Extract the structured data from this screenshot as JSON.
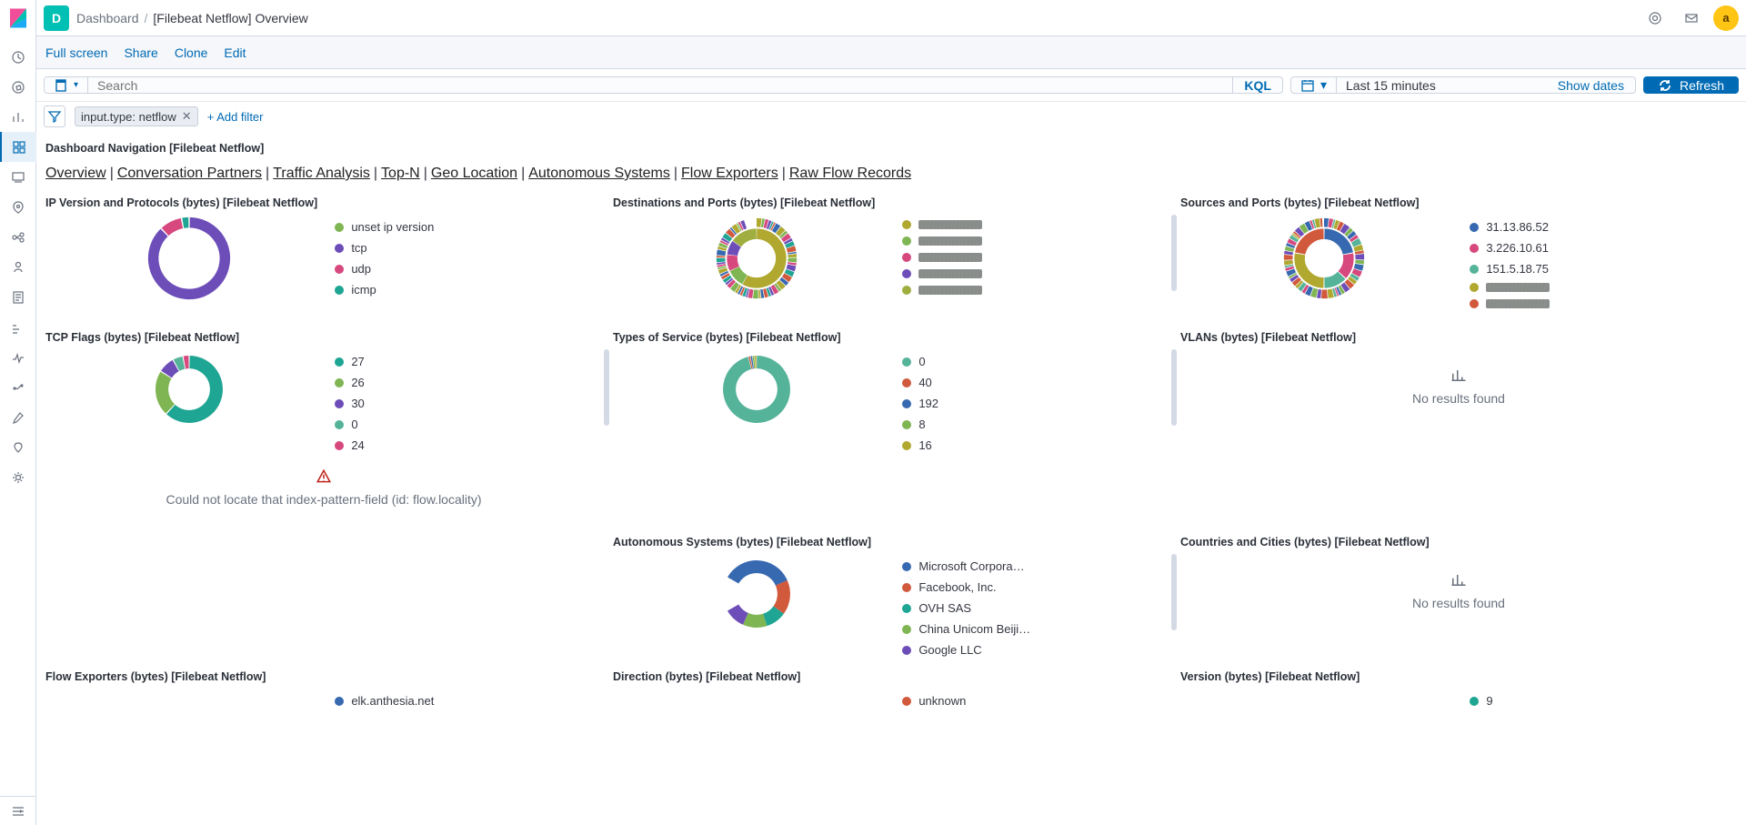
{
  "app": {
    "space_initial": "D",
    "breadcrumb_root": "Dashboard",
    "breadcrumb_current": "[Filebeat Netflow] Overview",
    "avatar_initial": "a"
  },
  "toolbar": {
    "fullscreen": "Full screen",
    "share": "Share",
    "clone": "Clone",
    "edit": "Edit"
  },
  "search": {
    "placeholder": "Search",
    "lang": "KQL"
  },
  "time": {
    "range": "Last 15 minutes",
    "show_dates": "Show dates",
    "refresh": "Refresh"
  },
  "filters": {
    "pill": "input.type: netflow",
    "add": "+ Add filter"
  },
  "nav_panel_title": "Dashboard Navigation [Filebeat Netflow]",
  "nav_links": [
    "Overview",
    "Conversation Partners",
    "Traffic Analysis",
    "Top-N",
    "Geo Location",
    "Autonomous Systems",
    "Flow Exporters",
    "Raw Flow Records"
  ],
  "panels": {
    "ipver": "IP Version and Protocols (bytes) [Filebeat Netflow]",
    "dest": "Destinations and Ports (bytes) [Filebeat Netflow]",
    "src": "Sources and Ports (bytes) [Filebeat Netflow]",
    "tcp": "TCP Flags (bytes) [Filebeat Netflow]",
    "tos": "Types of Service (bytes) [Filebeat Netflow]",
    "vlan": "VLANs (bytes) [Filebeat Netflow]",
    "as": "Autonomous Systems (bytes) [Filebeat Netflow]",
    "cc": "Countries and Cities (bytes) [Filebeat Netflow]",
    "fe": "Flow Exporters (bytes) [Filebeat Netflow]",
    "dir": "Direction (bytes) [Filebeat Netflow]",
    "ver": "Version (bytes) [Filebeat Netflow]"
  },
  "no_results": "No results found",
  "error_locality": "Could not locate that index-pattern-field (id: flow.locality)",
  "chart_data": [
    {
      "id": "ipver",
      "type": "pie",
      "title": "IP Version and Protocols (bytes)",
      "ring": 0,
      "series": [
        {
          "name": "unset ip version",
          "value": 100,
          "color": "#54b399"
        }
      ]
    },
    {
      "id": "ipver",
      "type": "pie",
      "title": "IP Version and Protocols – protocol",
      "ring": 1,
      "series": [
        {
          "name": "tcp",
          "value": 88,
          "color": "#6d4db8"
        },
        {
          "name": "udp",
          "value": 9,
          "color": "#d6487e"
        },
        {
          "name": "icmp",
          "value": 3,
          "color": "#1ea593"
        }
      ]
    },
    {
      "id": "dest",
      "type": "pie",
      "title": "Destinations and Ports (bytes)",
      "note": "legend labels unreadable",
      "series": [
        {
          "name": "dest-1",
          "value": 58,
          "color": "#b0a82f"
        },
        {
          "name": "dest-2",
          "value": 10,
          "color": "#7fb553"
        },
        {
          "name": "dest-3",
          "value": 9,
          "color": "#d6487e"
        },
        {
          "name": "dest-4",
          "value": 8,
          "color": "#6d4db8"
        },
        {
          "name": "dest-5",
          "value": 15,
          "color": "#9fae3f"
        }
      ]
    },
    {
      "id": "src",
      "type": "pie",
      "title": "Sources and Ports (bytes)",
      "series": [
        {
          "name": "31.13.86.52",
          "value": 22,
          "color": "#3769b1"
        },
        {
          "name": "3.226.10.61",
          "value": 15,
          "color": "#d6487e"
        },
        {
          "name": "151.5.18.75",
          "value": 13,
          "color": "#54b399"
        },
        {
          "name": "src-4",
          "value": 28,
          "color": "#b0a82f"
        },
        {
          "name": "src-5",
          "value": 22,
          "color": "#d1593c"
        }
      ]
    },
    {
      "id": "tcp",
      "type": "pie",
      "title": "TCP Flags (bytes)",
      "series": [
        {
          "name": "27",
          "value": 62,
          "color": "#1ea593"
        },
        {
          "name": "26",
          "value": 22,
          "color": "#7fb553"
        },
        {
          "name": "30",
          "value": 8,
          "color": "#6d4db8"
        },
        {
          "name": "0",
          "value": 5,
          "color": "#54b399"
        },
        {
          "name": "24",
          "value": 3,
          "color": "#d6487e"
        }
      ]
    },
    {
      "id": "tos",
      "type": "pie",
      "title": "Types of Service (bytes)",
      "series": [
        {
          "name": "0",
          "value": 96,
          "color": "#54b399"
        },
        {
          "name": "40",
          "value": 1,
          "color": "#d1593c"
        },
        {
          "name": "192",
          "value": 1,
          "color": "#3769b1"
        },
        {
          "name": "8",
          "value": 1,
          "color": "#7fb553"
        },
        {
          "name": "16",
          "value": 1,
          "color": "#b0a82f"
        }
      ]
    },
    {
      "id": "vlan",
      "type": "pie",
      "title": "VLANs (bytes)",
      "series": [],
      "empty": true
    },
    {
      "id": "as",
      "type": "pie",
      "title": "Autonomous Systems (bytes)",
      "series": [
        {
          "name": "Microsoft Corpora…",
          "value": 42,
          "color": "#3769b1"
        },
        {
          "name": "Facebook, Inc.",
          "value": 20,
          "color": "#d1593c"
        },
        {
          "name": "OVH SAS",
          "value": 12,
          "color": "#1ea593"
        },
        {
          "name": "China Unicom Beiji…",
          "value": 14,
          "color": "#7fb553"
        },
        {
          "name": "Google LLC",
          "value": 12,
          "color": "#6d4db8"
        }
      ]
    },
    {
      "id": "cc",
      "type": "pie",
      "title": "Countries and Cities (bytes)",
      "series": [],
      "empty": true
    },
    {
      "id": "fe",
      "type": "pie",
      "title": "Flow Exporters (bytes)",
      "series": [
        {
          "name": "elk.anthesia.net",
          "value": 100,
          "color": "#3769b1"
        }
      ]
    },
    {
      "id": "dir",
      "type": "pie",
      "title": "Direction (bytes)",
      "series": [
        {
          "name": "unknown",
          "value": 100,
          "color": "#d1593c"
        }
      ]
    },
    {
      "id": "ver",
      "type": "pie",
      "title": "Version (bytes)",
      "series": [
        {
          "name": "9",
          "value": 100,
          "color": "#1ea593"
        }
      ]
    }
  ]
}
